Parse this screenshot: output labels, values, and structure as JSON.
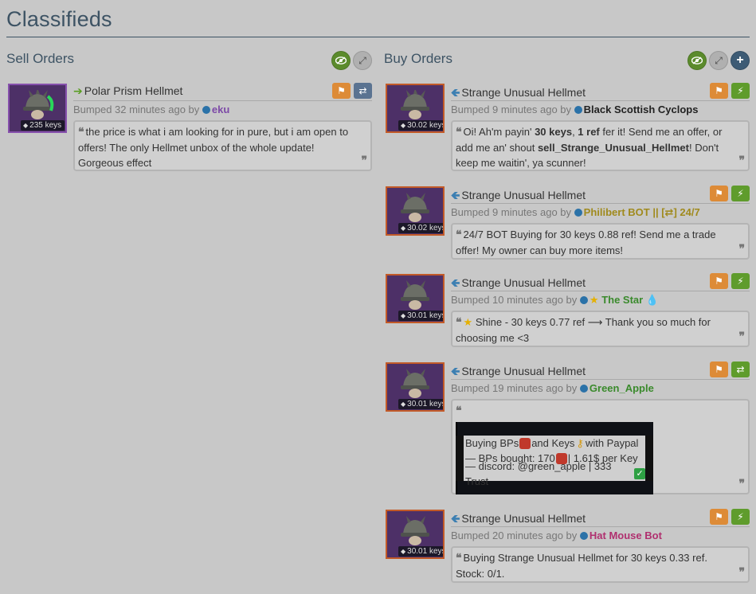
{
  "page_title": "Classifieds",
  "sell": {
    "title": "Sell Orders",
    "listings": [
      {
        "item_name": "Polar Prism Hellmet",
        "price": "235 keys",
        "bumped": "Bumped 32 minutes ago by",
        "user": "eku",
        "user_color": "#7d4aa7",
        "message": "the price is what i am looking for in pure, but i am open to offers! The only Hellmet unbox of the whole update! Gorgeous effect"
      }
    ]
  },
  "buy": {
    "title": "Buy Orders",
    "listings": [
      {
        "item_name": "Strange Unusual Hellmet",
        "price": "30.02 keys",
        "bumped": "Bumped 9 minutes ago by",
        "user": "Black Scottish Cyclops",
        "user_color": "#222222",
        "message": {
          "p1": "Oi! Ah'm payin' ",
          "b1": "30 keys",
          "p2": ", ",
          "b2": "1 ref",
          "p3": " fer it! Send me an offer, or add me an' shout ",
          "b3": "sell_Strange_Unusual_Hellmet",
          "p4": "! Don't keep me waitin', ya scunner!"
        }
      },
      {
        "item_name": "Strange Unusual Hellmet",
        "price": "30.02 keys",
        "bumped": "Bumped 9 minutes ago by",
        "user": "Philibert BOT || [⇄] 24/7",
        "user_color": "#a08a1d",
        "message": "24/7 BOT Buying for 30 keys 0.88 ref! Send me a trade offer! My owner can buy more items!"
      },
      {
        "item_name": "Strange Unusual Hellmet",
        "price": "30.01 keys",
        "bumped": "Bumped 10 minutes ago by",
        "user": "The Star",
        "user_color": "#3a8a2c",
        "message": "Shine - 30 keys 0.77 ref ⟶ Thank you so much for choosing me <3"
      },
      {
        "item_name": "Strange Unusual Hellmet",
        "price": "30.01 keys",
        "bumped": "Bumped 19 minutes ago by",
        "user": "Green_Apple",
        "user_color": "#3a8a2c",
        "message_lines": {
          "l1a": "Buying BPs",
          "l1b": " and Keys",
          "l1c": " with Paypal",
          "l2a": "— BPs bought: 170",
          "l2b": "| 1.61$ per Key",
          "l3": "— discord: @green_apple | 333 Trust"
        }
      },
      {
        "item_name": "Strange Unusual Hellmet",
        "price": "30.01 keys",
        "bumped": "Bumped 20 minutes ago by",
        "user": "Hat Mouse Bot",
        "user_color": "#b0306f",
        "message": "Buying Strange Unusual Hellmet for 30 keys 0.33 ref. Stock: 0/1."
      }
    ]
  },
  "icons": {
    "quote_open": "❝",
    "quote_close": "❞",
    "tag": "🏷",
    "flag": "⚑",
    "lightning": "⚡",
    "swap": "⇄",
    "eye": "◉",
    "expand": "⤢",
    "plus": "+"
  }
}
